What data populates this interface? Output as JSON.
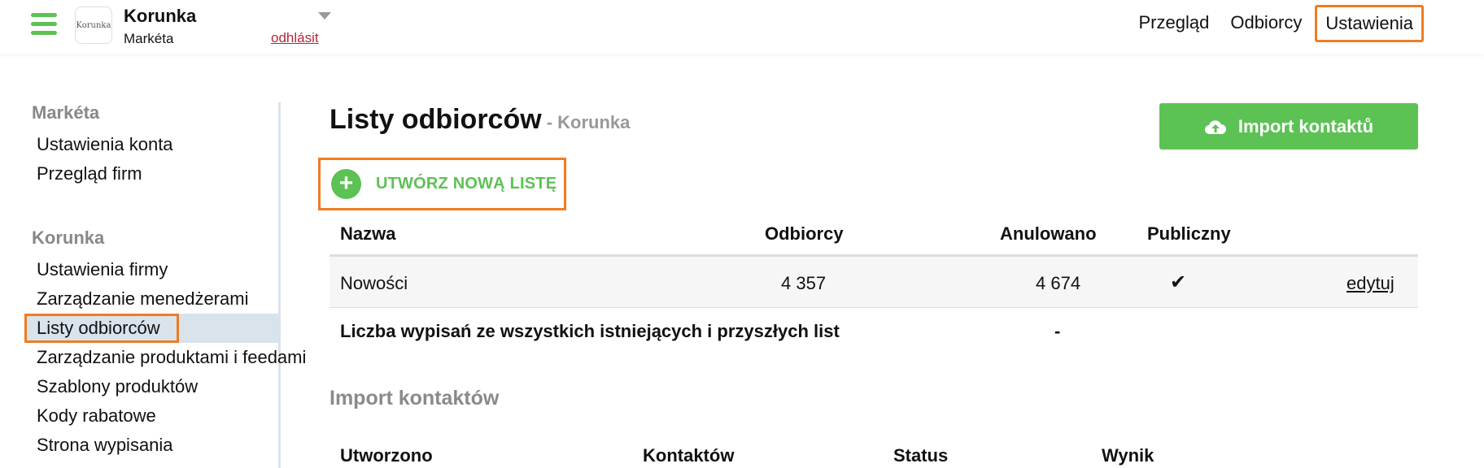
{
  "header": {
    "brand_logo_text": "Korunka",
    "brand_name": "Korunka",
    "user_name": "Markéta",
    "logout_label": "odhlásit",
    "nav": [
      {
        "label": "Przegląd"
      },
      {
        "label": "Odbiorcy"
      },
      {
        "label": "Ustawienia"
      }
    ]
  },
  "sidebar": {
    "group1_title": "Markéta",
    "group1_items": [
      {
        "label": "Ustawienia konta"
      },
      {
        "label": "Przegląd firm"
      }
    ],
    "group2_title": "Korunka",
    "group2_items": [
      {
        "label": "Ustawienia firmy"
      },
      {
        "label": "Zarządzanie menedżerami"
      },
      {
        "label": "Listy odbiorców"
      },
      {
        "label": "Zarządzanie produktami i feedami"
      },
      {
        "label": "Szablony produktów"
      },
      {
        "label": "Kody rabatowe"
      },
      {
        "label": "Strona wypisania"
      }
    ]
  },
  "main": {
    "title": "Listy odbiorców",
    "subtitle": "- Korunka",
    "import_button": "Import kontaktů",
    "create_button": "UTWÓRZ NOWĄ LISTĘ",
    "table": {
      "headers": [
        "Nazwa",
        "Odbiorcy",
        "Anulowano",
        "Publiczny"
      ],
      "rows": [
        {
          "name": "Nowości",
          "recipients": "4 357",
          "cancelled": "4 674",
          "public_mark": "✔",
          "action": "edytuj"
        }
      ],
      "total_label": "Liczba wypisań ze wszystkich istniejących i przyszłych list",
      "total_value": "-"
    },
    "import_section": {
      "title": "Import kontaktów",
      "headers": [
        "Utworzono",
        "Kontaktów",
        "Status",
        "Wynik"
      ]
    }
  },
  "colors": {
    "accent_green": "#5cc254",
    "highlight_orange": "#ef7c22",
    "logout_red": "#b6283a",
    "sidebar_selected": "#d8e3ec"
  },
  "icons": {
    "menu": "hamburger-menu-icon",
    "upload": "cloud-upload-icon",
    "plus": "plus-circle-icon",
    "caret": "caret-down-icon",
    "check": "checkmark-icon"
  }
}
